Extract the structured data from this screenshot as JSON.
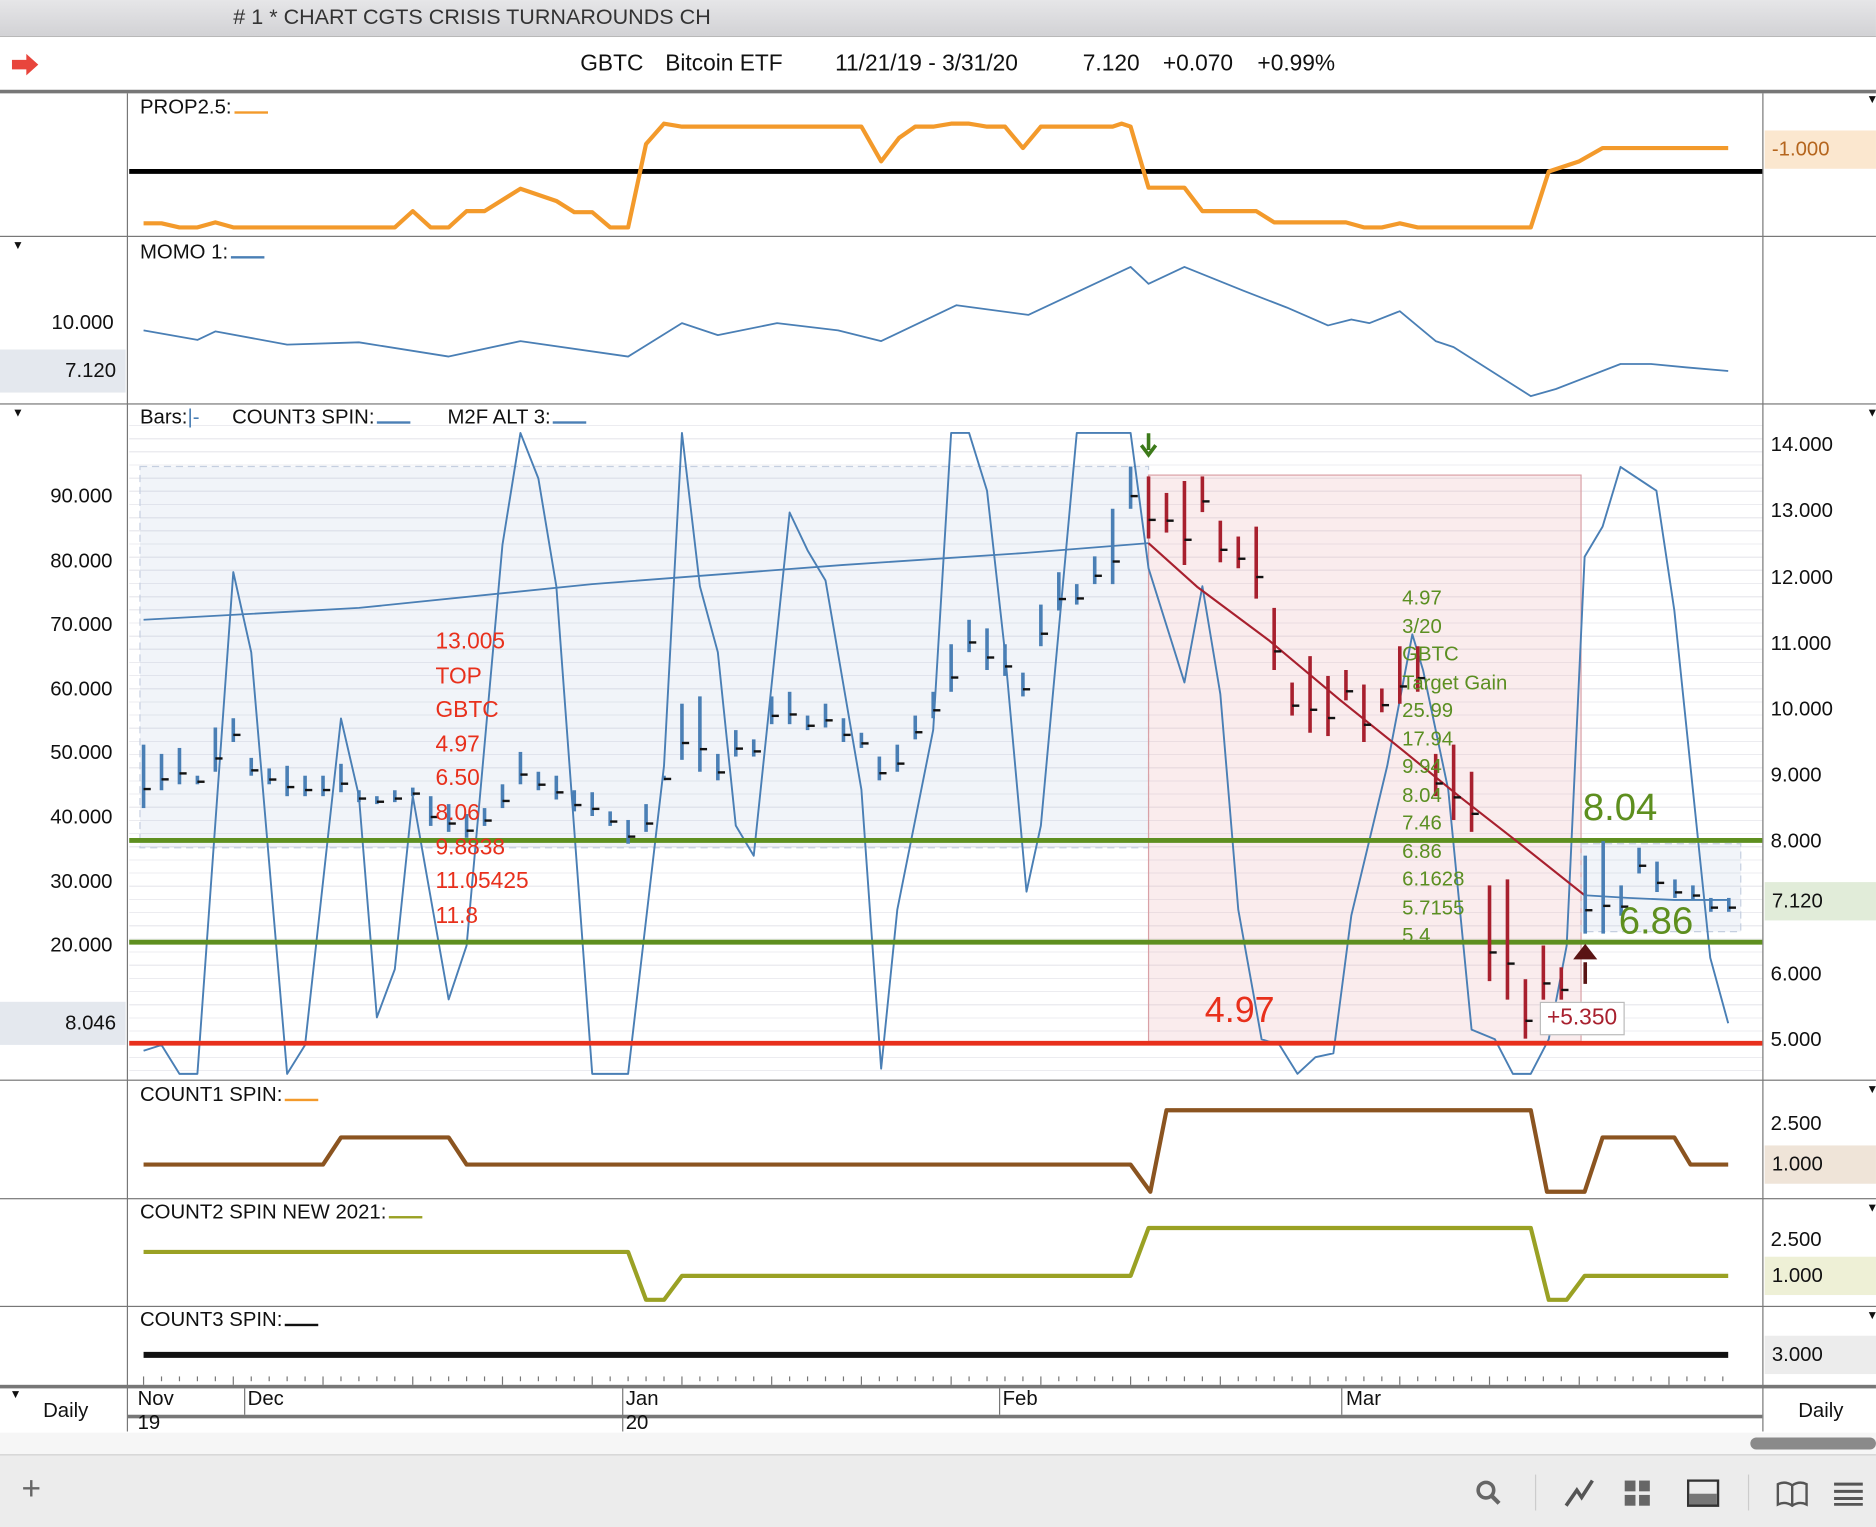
{
  "window_title": "# 1 * CHART CGTS CRISIS TURNAROUNDS CH",
  "header": {
    "symbol": "GBTC",
    "name": "Bitcoin ETF",
    "range": "11/21/19 - 3/31/20",
    "last": "7.120",
    "change": "+0.070",
    "pct": "+0.99%"
  },
  "colors": {
    "orange": "#f39a2b",
    "blue": "#4a7fb5",
    "red_bar": "#a8202e",
    "green_line": "#5e8f1f",
    "red_line": "#e8301c",
    "brown": "#8b5420",
    "olive": "#9aa124"
  },
  "panels": {
    "prop": {
      "label": "PROP2.5:",
      "right_value": "-1.000"
    },
    "momo": {
      "label": "MOMO 1:",
      "left_tick": "10.000",
      "left_box": "7.120"
    },
    "main": {
      "bars_label": "Bars:",
      "bars_glyph": "|-",
      "count3_label": "COUNT3 SPIN:",
      "m2f_label": "M2F ALT 3:",
      "left_ticks": [
        "90.000",
        "80.000",
        "70.000",
        "60.000",
        "50.000",
        "40.000",
        "30.000",
        "20.000"
      ],
      "right_ticks": [
        "14.000",
        "13.000",
        "12.000",
        "11.000",
        "10.000",
        "9.000",
        "8.000",
        "6.000",
        "5.000"
      ],
      "left_box": "8.046",
      "right_box": "7.120",
      "red_notes": [
        "13.005",
        "TOP",
        "GBTC",
        "4.97",
        "6.50",
        "8.06",
        "9.8838",
        "11.05425",
        "11.8"
      ],
      "green_notes": [
        "4.97",
        "3/20",
        "GBTC",
        "Target Gain",
        "25.99",
        "17.94",
        "9.94",
        "8.04",
        "7.46",
        "6.86",
        "6.1628",
        "5.7155",
        "5.4"
      ],
      "big_green_top": "8.04",
      "big_green_bottom": "6.86",
      "big_red": "4.97",
      "gain_box": "+5.350"
    },
    "count1": {
      "label": "COUNT1 SPIN:",
      "ticks": [
        "2.500"
      ],
      "box": "1.000"
    },
    "count2": {
      "label": "COUNT2 SPIN NEW 2021:",
      "ticks": [
        "2.500"
      ],
      "box": "1.000"
    },
    "count3": {
      "label": "COUNT3 SPIN:",
      "box": "3.000"
    }
  },
  "date_axis": {
    "months": [
      "Nov",
      "Dec",
      "Jan",
      "Feb",
      "Mar"
    ],
    "years": [
      "19",
      "20"
    ],
    "period_left": "Daily",
    "period_right": "Daily"
  },
  "chart_data": {
    "type": "line",
    "x_unit": "trading day index from 11/21/19",
    "price_bars": {
      "name": "GBTC",
      "unit": "price",
      "format": "[high, low] per day index 0..88",
      "red_segment": [
        56,
        79
      ],
      "values": [
        [
          9.49,
          8.53
        ],
        [
          9.35,
          8.8
        ],
        [
          9.44,
          8.89
        ],
        [
          9.02,
          8.89
        ],
        [
          9.75,
          9.08
        ],
        [
          9.89,
          9.53
        ],
        [
          9.29,
          9.02
        ],
        [
          9.13,
          8.89
        ],
        [
          9.17,
          8.71
        ],
        [
          9.02,
          8.71
        ],
        [
          9.02,
          8.71
        ],
        [
          9.2,
          8.77
        ],
        [
          8.8,
          8.62
        ],
        [
          8.71,
          8.59
        ],
        [
          8.8,
          8.62
        ],
        [
          8.84,
          8.71
        ],
        [
          8.71,
          8.26
        ],
        [
          8.59,
          8.17
        ],
        [
          8.44,
          8.08
        ],
        [
          8.53,
          8.26
        ],
        [
          8.89,
          8.53
        ],
        [
          9.38,
          8.89
        ],
        [
          9.08,
          8.8
        ],
        [
          9.02,
          8.66
        ],
        [
          8.8,
          8.48
        ],
        [
          8.77,
          8.41
        ],
        [
          8.48,
          8.26
        ],
        [
          8.35,
          7.99
        ],
        [
          8.59,
          8.17
        ],
        [
          9.02,
          8.95
        ],
        [
          10.11,
          9.26
        ],
        [
          10.22,
          9.08
        ],
        [
          9.35,
          8.95
        ],
        [
          9.71,
          9.31
        ],
        [
          9.57,
          9.31
        ],
        [
          10.22,
          9.8
        ],
        [
          10.29,
          9.8
        ],
        [
          9.93,
          9.71
        ],
        [
          10.11,
          9.75
        ],
        [
          9.89,
          9.53
        ],
        [
          9.67,
          9.44
        ],
        [
          9.31,
          8.95
        ],
        [
          9.49,
          9.08
        ],
        [
          9.93,
          9.57
        ],
        [
          10.29,
          9.89
        ],
        [
          11.01,
          10.29
        ],
        [
          11.38,
          10.89
        ],
        [
          11.25,
          10.62
        ],
        [
          11.01,
          10.53
        ],
        [
          10.58,
          10.22
        ],
        [
          11.61,
          10.98
        ],
        [
          12.1,
          11.52
        ],
        [
          11.92,
          11.61
        ],
        [
          12.34,
          11.92
        ],
        [
          13.06,
          11.92
        ],
        [
          13.7,
          13.06
        ],
        [
          13.55,
          12.61
        ],
        [
          13.3,
          12.7
        ],
        [
          13.48,
          12.21
        ],
        [
          13.55,
          13.01
        ],
        [
          12.88,
          12.25
        ],
        [
          12.64,
          12.16
        ],
        [
          12.79,
          11.7
        ],
        [
          11.56,
          10.62
        ],
        [
          10.43,
          9.93
        ],
        [
          10.83,
          9.67
        ],
        [
          10.53,
          9.62
        ],
        [
          10.62,
          10.16
        ],
        [
          10.4,
          9.53
        ],
        [
          10.34,
          9.98
        ],
        [
          10.98,
          10.11
        ],
        [
          10.98,
          10.29
        ],
        [
          9.35,
          8.71
        ],
        [
          9.49,
          8.35
        ],
        [
          9.08,
          8.17
        ],
        [
          7.36,
          5.91
        ],
        [
          7.45,
          5.63
        ],
        [
          5.94,
          5.04
        ],
        [
          6.45,
          5.63
        ],
        [
          6.12,
          5.63
        ],
        [
          7.81,
          6.63
        ],
        [
          8.03,
          6.63
        ],
        [
          7.36,
          6.9
        ],
        [
          7.93,
          7.54
        ],
        [
          7.72,
          7.26
        ],
        [
          7.45,
          7.17
        ],
        [
          7.36,
          7.14
        ],
        [
          7.17,
          6.96
        ],
        [
          7.17,
          6.96
        ]
      ]
    },
    "moving_average": {
      "unit": "price",
      "blue": [
        [
          0,
          11.38
        ],
        [
          12,
          11.56
        ],
        [
          25,
          11.92
        ],
        [
          39,
          12.21
        ],
        [
          49,
          12.39
        ],
        [
          56,
          12.54
        ]
      ],
      "red": [
        [
          56,
          12.54
        ],
        [
          58.7,
          11.88
        ],
        [
          62.7,
          11.07
        ],
        [
          66.7,
          10.16
        ],
        [
          70,
          9.44
        ],
        [
          73.3,
          8.71
        ],
        [
          76.7,
          7.99
        ],
        [
          80.3,
          7.21
        ]
      ],
      "blue_after": [
        [
          80.3,
          7.21
        ],
        [
          82.7,
          7.17
        ],
        [
          85.3,
          7.14
        ],
        [
          88.3,
          7.14
        ]
      ]
    },
    "m2f_alt3": {
      "unit": "left axis",
      "points": [
        [
          0,
          3.6
        ],
        [
          1,
          4.5
        ],
        [
          2,
          0
        ],
        [
          3,
          0
        ],
        [
          5,
          78.2
        ],
        [
          6,
          65.7
        ],
        [
          8,
          0
        ],
        [
          9,
          4.5
        ],
        [
          11,
          55.4
        ],
        [
          12,
          43.3
        ],
        [
          13,
          8.8
        ],
        [
          14,
          16.3
        ],
        [
          15,
          43.3
        ],
        [
          17,
          11.6
        ],
        [
          18,
          20
        ],
        [
          20,
          82.5
        ],
        [
          21,
          99.9
        ],
        [
          22,
          92.8
        ],
        [
          23,
          76
        ],
        [
          25,
          0
        ],
        [
          27,
          0
        ],
        [
          29,
          48
        ],
        [
          30,
          99.9
        ],
        [
          31,
          76
        ],
        [
          32,
          65.7
        ],
        [
          33,
          38.7
        ],
        [
          34,
          34
        ],
        [
          36,
          87.5
        ],
        [
          37,
          81.6
        ],
        [
          38,
          76.9
        ],
        [
          40,
          44.3
        ],
        [
          41.1,
          0.8
        ],
        [
          42,
          25.6
        ],
        [
          44,
          53.6
        ],
        [
          45,
          99.9
        ],
        [
          46,
          99.9
        ],
        [
          47,
          90.9
        ],
        [
          48,
          65.7
        ],
        [
          49.2,
          28.4
        ],
        [
          50,
          38.7
        ],
        [
          52,
          99.9
        ],
        [
          55,
          99.9
        ],
        [
          56,
          78.8
        ],
        [
          58,
          61
        ],
        [
          59,
          76
        ],
        [
          60,
          59.2
        ],
        [
          61,
          25.6
        ],
        [
          62.3,
          5.4
        ],
        [
          63.3,
          4.5
        ],
        [
          64.3,
          0
        ],
        [
          65.3,
          2.6
        ],
        [
          66.3,
          3.2
        ],
        [
          67.3,
          24.7
        ],
        [
          69.3,
          48
        ],
        [
          70.7,
          68.5
        ],
        [
          71.3,
          62.9
        ],
        [
          72.7,
          44.3
        ],
        [
          74,
          6.9
        ],
        [
          75.3,
          5.4
        ],
        [
          76.3,
          0
        ],
        [
          77.3,
          0
        ],
        [
          78.3,
          5.4
        ],
        [
          79.3,
          20
        ],
        [
          80.3,
          80.6
        ],
        [
          81.3,
          85.3
        ],
        [
          82.3,
          94.6
        ],
        [
          84.3,
          90.9
        ],
        [
          85.3,
          72.2
        ],
        [
          87.3,
          18.1
        ],
        [
          88.3,
          7.9
        ]
      ]
    },
    "prop25": {
      "unit": "normalized",
      "points": [
        [
          0,
          0.04
        ],
        [
          1,
          0.04
        ],
        [
          2,
          0
        ],
        [
          3,
          0
        ],
        [
          4,
          0.05
        ],
        [
          5,
          0
        ],
        [
          14,
          0
        ],
        [
          15,
          0.16
        ],
        [
          16,
          0
        ],
        [
          17,
          0
        ],
        [
          18,
          0.16
        ],
        [
          19,
          0.16
        ],
        [
          21,
          0.38
        ],
        [
          23,
          0.26
        ],
        [
          24,
          0.15
        ],
        [
          25,
          0.15
        ],
        [
          26,
          0
        ],
        [
          27,
          0
        ],
        [
          28,
          0.82
        ],
        [
          29,
          1.02
        ],
        [
          30,
          0.99
        ],
        [
          40,
          0.99
        ],
        [
          41.1,
          0.65
        ],
        [
          42.1,
          0.88
        ],
        [
          43,
          0.99
        ],
        [
          44,
          0.99
        ],
        [
          45,
          1.02
        ],
        [
          46,
          1.02
        ],
        [
          47,
          0.99
        ],
        [
          48,
          0.99
        ],
        [
          49,
          0.78
        ],
        [
          50,
          0.99
        ],
        [
          54,
          0.99
        ],
        [
          54.5,
          1.02
        ],
        [
          55,
          0.99
        ],
        [
          56,
          0.39
        ],
        [
          58,
          0.39
        ],
        [
          59,
          0.16
        ],
        [
          62,
          0.16
        ],
        [
          63,
          0.05
        ],
        [
          67,
          0.05
        ],
        [
          68,
          0
        ],
        [
          69,
          0
        ],
        [
          70,
          0.04
        ],
        [
          71,
          0
        ],
        [
          77.3,
          0
        ],
        [
          78.3,
          0.55
        ],
        [
          80,
          0.65
        ],
        [
          81.3,
          0.78
        ],
        [
          88.3,
          0.78
        ]
      ],
      "reference_level": 0.55
    },
    "momo1": {
      "unit": "left axis",
      "points": [
        [
          0,
          9.57
        ],
        [
          3,
          8.99
        ],
        [
          4,
          9.5
        ],
        [
          8,
          8.71
        ],
        [
          12,
          8.85
        ],
        [
          17,
          7.99
        ],
        [
          21,
          8.92
        ],
        [
          27,
          7.99
        ],
        [
          30,
          10
        ],
        [
          32,
          9.28
        ],
        [
          35.3,
          10
        ],
        [
          38.7,
          9.57
        ],
        [
          41.1,
          8.92
        ],
        [
          45.3,
          11.08
        ],
        [
          49.3,
          10.5
        ],
        [
          55,
          13.38
        ],
        [
          56,
          12.37
        ],
        [
          58,
          13.38
        ],
        [
          61.3,
          11.94
        ],
        [
          63.7,
          10.94
        ],
        [
          66,
          9.86
        ],
        [
          67.3,
          10.22
        ],
        [
          68.3,
          10
        ],
        [
          70,
          10.72
        ],
        [
          72,
          8.92
        ],
        [
          73,
          8.56
        ],
        [
          77.3,
          5.61
        ],
        [
          78.7,
          6.04
        ],
        [
          82.3,
          7.55
        ],
        [
          84,
          7.55
        ],
        [
          86,
          7.34
        ],
        [
          88.3,
          7.12
        ]
      ]
    },
    "count1": {
      "points": [
        [
          0,
          1
        ],
        [
          10,
          1
        ],
        [
          11,
          2
        ],
        [
          17,
          2
        ],
        [
          18,
          1
        ],
        [
          55,
          1
        ],
        [
          56.1,
          0
        ],
        [
          57,
          3
        ],
        [
          77.3,
          3
        ],
        [
          78.2,
          0
        ],
        [
          80.3,
          0
        ],
        [
          81.3,
          2
        ],
        [
          85.3,
          2
        ],
        [
          86.2,
          1
        ],
        [
          88.3,
          1
        ]
      ]
    },
    "count2": {
      "points": [
        [
          0,
          2
        ],
        [
          27,
          2
        ],
        [
          28,
          0
        ],
        [
          29,
          0
        ],
        [
          30,
          1
        ],
        [
          55,
          1
        ],
        [
          56,
          3
        ],
        [
          77.3,
          3
        ],
        [
          78.3,
          0
        ],
        [
          79.3,
          0
        ],
        [
          80.3,
          1
        ],
        [
          88.3,
          1
        ]
      ]
    },
    "count3": {
      "points": [
        [
          0,
          3
        ],
        [
          88.3,
          3
        ]
      ]
    },
    "levels": {
      "green_upper": 8.04,
      "green_lower": 6.5,
      "red": 4.97
    },
    "zones": [
      {
        "color": "blue",
        "from_day": -0.2,
        "to_day": 56,
        "high": 13.7,
        "low": 7.93
      },
      {
        "color": "pink",
        "from_day": 56,
        "to_day": 80.1,
        "high": 13.57,
        "low": 5.0
      },
      {
        "color": "blue",
        "from_day": 80.1,
        "to_day": 89,
        "high": 7.99,
        "low": 6.66
      }
    ]
  }
}
